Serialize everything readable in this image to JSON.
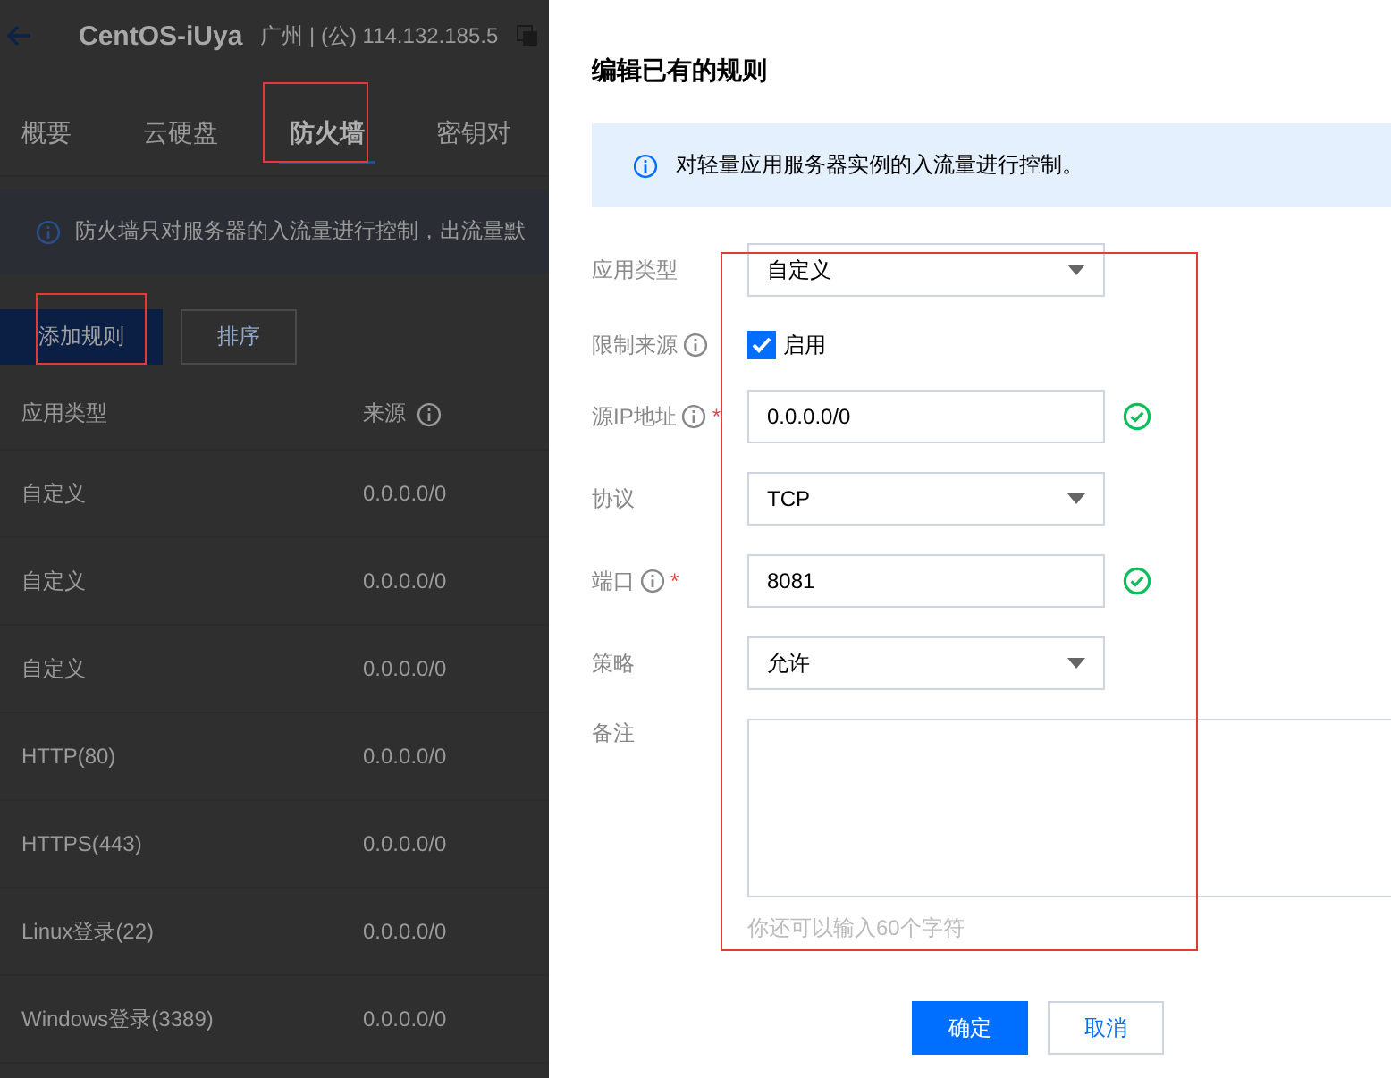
{
  "header": {
    "title": "CentOS-iUya",
    "subtitle": "广州 | (公) 114.132.185.5"
  },
  "tabs": [
    {
      "label": "概要",
      "selected": false
    },
    {
      "label": "云硬盘",
      "selected": false
    },
    {
      "label": "防火墙",
      "selected": true
    },
    {
      "label": "密钥对",
      "selected": false
    }
  ],
  "notice": "防火墙只对服务器的入流量进行控制，出流量默",
  "toolbar": [
    {
      "label": "添加规则",
      "kind": "primary"
    },
    {
      "label": "排序",
      "kind": "secondary"
    }
  ],
  "table": {
    "columns": [
      {
        "label": "应用类型",
        "info": false
      },
      {
        "label": "来源",
        "info": true
      }
    ],
    "rows": [
      [
        "自定义",
        "0.0.0.0/0"
      ],
      [
        "自定义",
        "0.0.0.0/0"
      ],
      [
        "自定义",
        "0.0.0.0/0"
      ],
      [
        "HTTP(80)",
        "0.0.0.0/0"
      ],
      [
        "HTTPS(443)",
        "0.0.0.0/0"
      ],
      [
        "Linux登录(22)",
        "0.0.0.0/0"
      ],
      [
        "Windows登录(3389)",
        "0.0.0.0/0"
      ]
    ]
  },
  "dialog": {
    "title": "编辑已有的规则",
    "notice": "对轻量应用服务器实例的入流量进行控制。",
    "fields": [
      {
        "label": "应用类型",
        "kind": "select",
        "value": "自定义",
        "info": false,
        "required": false,
        "valid": false
      },
      {
        "label": "限制来源",
        "kind": "checkbox",
        "value": "启用",
        "checked": true,
        "info": true,
        "required": false,
        "valid": false
      },
      {
        "label": "源IP地址",
        "kind": "text",
        "value": "0.0.0.0/0",
        "info": true,
        "required": true,
        "required_mark": "*",
        "valid": true
      },
      {
        "label": "协议",
        "kind": "select",
        "value": "TCP",
        "info": false,
        "required": false,
        "valid": false
      },
      {
        "label": "端口",
        "kind": "text",
        "value": "8081",
        "info": true,
        "required": true,
        "required_mark": "*",
        "valid": true
      },
      {
        "label": "策略",
        "kind": "select",
        "value": "允许",
        "info": false,
        "required": false,
        "valid": false
      },
      {
        "label": "备注",
        "kind": "textarea",
        "hint": "你还可以输入60个字符",
        "info": false,
        "required": false,
        "valid": false
      }
    ],
    "buttons": [
      {
        "label": "确定",
        "kind": "primary"
      },
      {
        "label": "取消",
        "kind": "secondary"
      }
    ]
  }
}
